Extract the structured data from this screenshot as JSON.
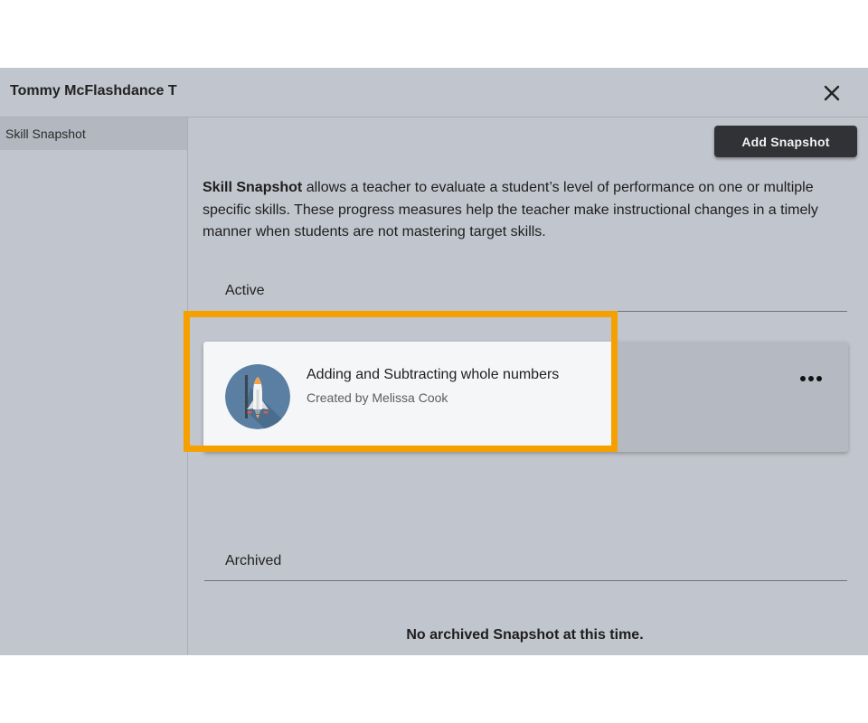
{
  "header": {
    "title": "Tommy McFlashdance T",
    "close_icon": "close-icon"
  },
  "sidebar": {
    "items": [
      {
        "label": "Skill Snapshot",
        "active": true
      }
    ]
  },
  "toolbar": {
    "add_label": "Add Snapshot"
  },
  "description": {
    "lead": "Skill Snapshot",
    "text": " allows a teacher to evaluate a student’s level of performance on one or multiple specific skills. These progress measures help the teacher make instructional changes in a timely manner when students are not mastering target skills."
  },
  "sections": {
    "active": {
      "label": "Active",
      "cards": [
        {
          "title": "Adding and Subtracting whole numbers",
          "subtitle": "Created by Melissa Cook",
          "icon": "rocket-icon"
        }
      ]
    },
    "archived": {
      "label": "Archived",
      "empty_message": "No archived Snapshot at this time."
    }
  },
  "colors": {
    "modal_bg": "#c1c5cd",
    "button_bg": "#303236",
    "highlight_border": "#f6a000",
    "avatar_bg": "#5a7fa3"
  }
}
